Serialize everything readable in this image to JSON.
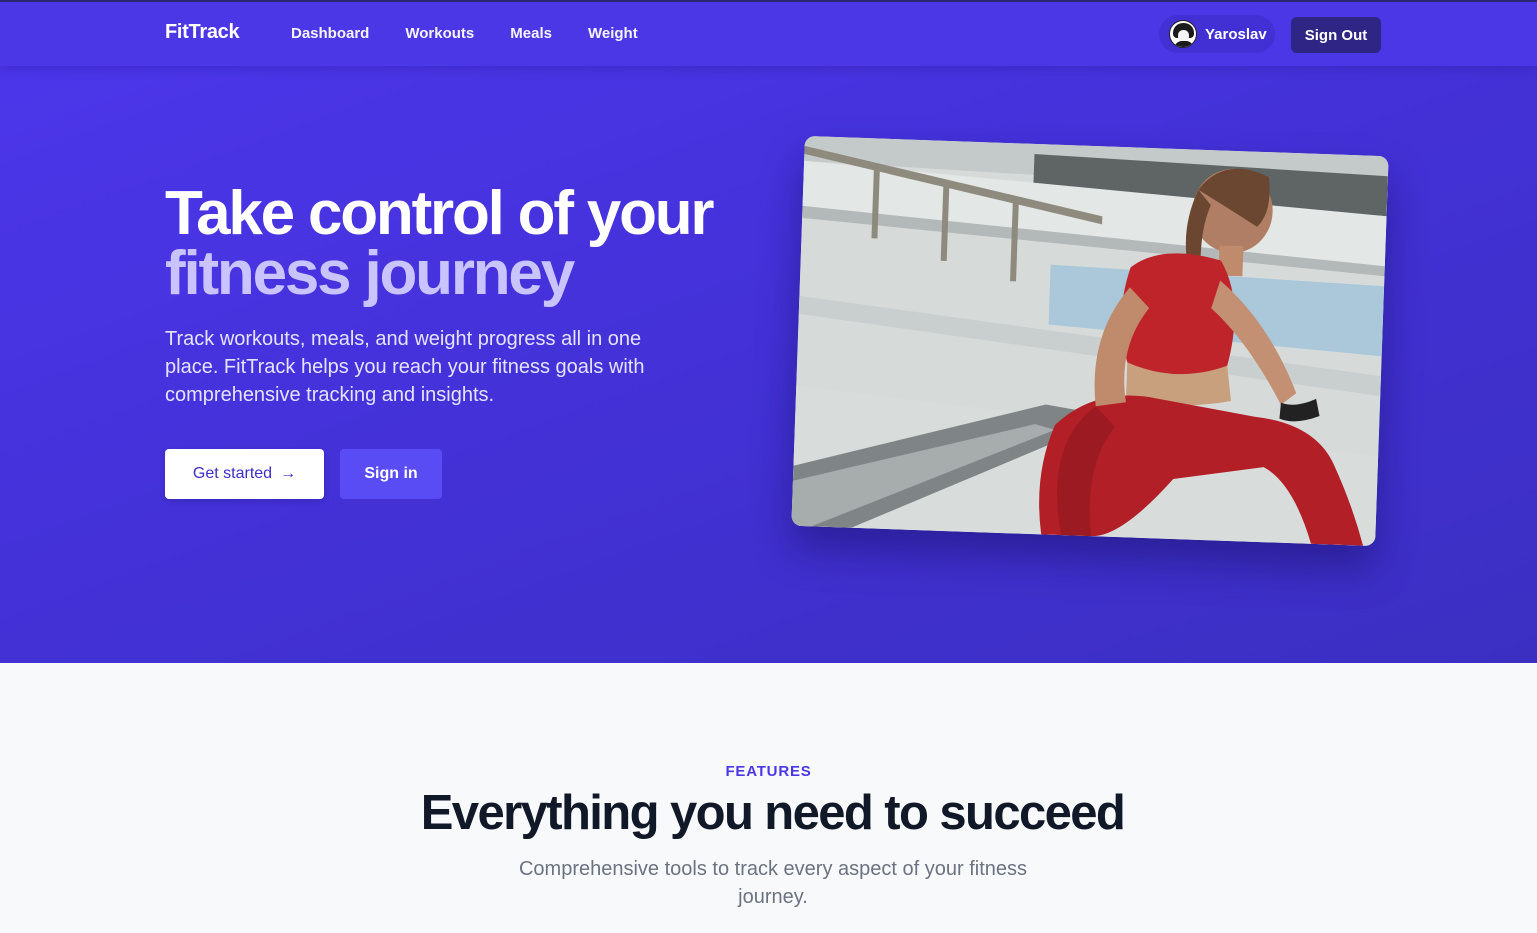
{
  "nav": {
    "brand": "FitTrack",
    "links": [
      "Dashboard",
      "Workouts",
      "Meals",
      "Weight"
    ],
    "user_name": "Yaroslav",
    "sign_out": "Sign Out"
  },
  "hero": {
    "title_line1": "Take control of your",
    "title_line2": "fitness journey",
    "subtitle": "Track workouts, meals, and weight progress all in one place. FitTrack helps you reach your fitness goals with comprehensive tracking and insights.",
    "primary_button": "Get started",
    "primary_button_icon": "arrow-right-icon",
    "secondary_button": "Sign in",
    "image_alt": "Woman in red workout outfit checking her smartwatch while sitting on steps"
  },
  "features": {
    "eyebrow": "FEATURES",
    "title": "Everything you need to succeed",
    "subtitle": "Comprehensive tools to track every aspect of your fitness journey."
  },
  "colors": {
    "brand_primary": "#4b37e6",
    "hero_accent_text": "#c9c4ff",
    "sign_out_bg": "#2f2585",
    "secondary_button_bg": "#5a4cf5",
    "heading_dark": "#111827",
    "muted_text": "#6b7280"
  }
}
